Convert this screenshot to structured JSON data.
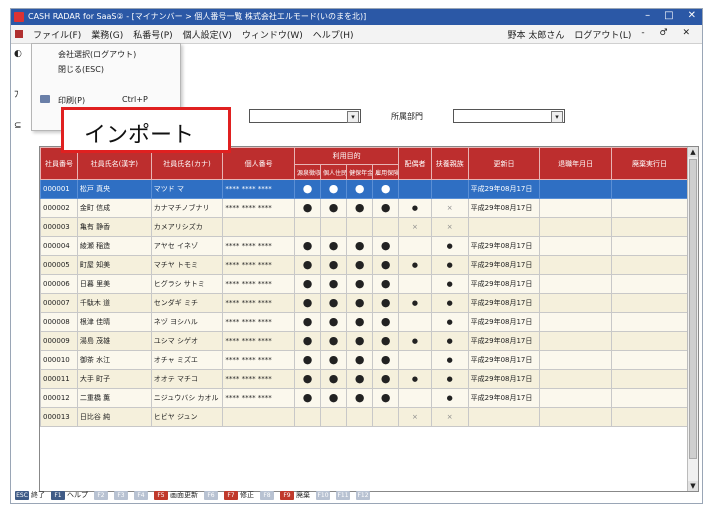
{
  "window": {
    "title": "CASH RADAR for SaaS② - [マイナンバー > 個人番号一覧 株式会社エルモード(いのまを北)]",
    "controls": [
      "–",
      "□",
      "✕"
    ]
  },
  "menubar": {
    "items": [
      "ファイル(F)",
      "業務(G)",
      "私番号(P)",
      "個人設定(V)",
      "ウィンドウ(W)",
      "ヘルプ(H)"
    ],
    "user": "野本 太郎さん",
    "logout": "ログアウト(L)",
    "mdi_controls": "- ♂ ✕"
  },
  "file_menu": {
    "items": [
      "会社選択(ログアウト)",
      "閉じる(ESC)",
      "印刷(P)"
    ],
    "print_shortcut": "Ctrl+P"
  },
  "import_callout": "インポート",
  "filters": {
    "left_label": "⊆",
    "dept_label": "所属部門",
    "select1": "",
    "select2": ""
  },
  "table": {
    "headers": [
      "社員番号",
      "社員氏名(漢字)",
      "社員氏名(カナ)",
      "個人番号",
      "扶養控除",
      "",
      "",
      "",
      "配偶者",
      "扶養親族",
      "更新日",
      "退職年月日",
      "廃棄実行日"
    ],
    "subheaders": [
      "源泉徴収",
      "個人住民税",
      "健保年金",
      "雇用保険"
    ],
    "group_header": "利用目的",
    "rows": [
      {
        "id": "000001",
        "kanji": "松戸 真央",
        "kana": "マツド マ",
        "num": "**** **** ****",
        "p1": "●",
        "p2": "●",
        "p3": "●",
        "p4": "●",
        "sp": "",
        "fam": "",
        "date": "平成29年08月17日",
        "sel": true
      },
      {
        "id": "000002",
        "kanji": "金町 信成",
        "kana": "カナマチノブナリ",
        "num": "**** **** ****",
        "p1": "●",
        "p2": "●",
        "p3": "●",
        "p4": "●",
        "sp": "●",
        "fam": "×",
        "date": "平成29年08月17日",
        "sel": false
      },
      {
        "id": "000003",
        "kanji": "亀有 静香",
        "kana": "カメアリシズカ",
        "num": "",
        "p1": "",
        "p2": "",
        "p3": "",
        "p4": "",
        "sp": "×",
        "fam": "×",
        "date": "",
        "sel": false
      },
      {
        "id": "000004",
        "kanji": "綾瀬 稲造",
        "kana": "アヤセ イネゾ",
        "num": "**** **** ****",
        "p1": "●",
        "p2": "●",
        "p3": "●",
        "p4": "●",
        "sp": "",
        "fam": "●",
        "date": "平成29年08月17日",
        "sel": false
      },
      {
        "id": "000005",
        "kanji": "町屋 知美",
        "kana": "マチヤ トモミ",
        "num": "**** **** ****",
        "p1": "●",
        "p2": "●",
        "p3": "●",
        "p4": "●",
        "sp": "●",
        "fam": "●",
        "date": "平成29年08月17日",
        "sel": false
      },
      {
        "id": "000006",
        "kanji": "日暮 里美",
        "kana": "ヒグラシ サトミ",
        "num": "**** **** ****",
        "p1": "●",
        "p2": "●",
        "p3": "●",
        "p4": "●",
        "sp": "",
        "fam": "●",
        "date": "平成29年08月17日",
        "sel": false
      },
      {
        "id": "000007",
        "kanji": "千駄木 道",
        "kana": "センダギ ミチ",
        "num": "**** **** ****",
        "p1": "●",
        "p2": "●",
        "p3": "●",
        "p4": "●",
        "sp": "●",
        "fam": "●",
        "date": "平成29年08月17日",
        "sel": false
      },
      {
        "id": "000008",
        "kanji": "根津 佳晴",
        "kana": "ネヅ ヨシハル",
        "num": "**** **** ****",
        "p1": "●",
        "p2": "●",
        "p3": "●",
        "p4": "●",
        "sp": "",
        "fam": "●",
        "date": "平成29年08月17日",
        "sel": false
      },
      {
        "id": "000009",
        "kanji": "湯島 茂雄",
        "kana": "ユシマ シゲオ",
        "num": "**** **** ****",
        "p1": "●",
        "p2": "●",
        "p3": "●",
        "p4": "●",
        "sp": "●",
        "fam": "●",
        "date": "平成29年08月17日",
        "sel": false
      },
      {
        "id": "000010",
        "kanji": "御茶 水江",
        "kana": "オチャ ミズエ",
        "num": "**** **** ****",
        "p1": "●",
        "p2": "●",
        "p3": "●",
        "p4": "●",
        "sp": "",
        "fam": "●",
        "date": "平成29年08月17日",
        "sel": false
      },
      {
        "id": "000011",
        "kanji": "大手 町子",
        "kana": "オオテ マチコ",
        "num": "**** **** ****",
        "p1": "●",
        "p2": "●",
        "p3": "●",
        "p4": "●",
        "sp": "●",
        "fam": "●",
        "date": "平成29年08月17日",
        "sel": false
      },
      {
        "id": "000012",
        "kanji": "二重橋 薫",
        "kana": "ニジュウバシ カオル",
        "num": "**** **** ****",
        "p1": "●",
        "p2": "●",
        "p3": "●",
        "p4": "●",
        "sp": "",
        "fam": "●",
        "date": "平成29年08月17日",
        "sel": false
      },
      {
        "id": "000013",
        "kanji": "日比谷 純",
        "kana": "ヒビヤ ジュン",
        "num": "",
        "p1": "",
        "p2": "",
        "p3": "",
        "p4": "",
        "sp": "×",
        "fam": "×",
        "date": "",
        "sel": false
      }
    ]
  },
  "fnbar": [
    {
      "key": "ESC",
      "label": "終了",
      "style": "normal"
    },
    {
      "key": "F1",
      "label": "ヘルプ",
      "style": "normal"
    },
    {
      "key": "F2",
      "label": "",
      "style": "dim"
    },
    {
      "key": "F3",
      "label": "",
      "style": "dim"
    },
    {
      "key": "F4",
      "label": "",
      "style": "dim"
    },
    {
      "key": "F5",
      "label": "画面更新",
      "style": "normal"
    },
    {
      "key": "F6",
      "label": "",
      "style": "dim"
    },
    {
      "key": "F7",
      "label": "修正",
      "style": "normal"
    },
    {
      "key": "F8",
      "label": "",
      "style": "dim"
    },
    {
      "key": "F9",
      "label": "廃棄",
      "style": "normal"
    },
    {
      "key": "F10",
      "label": "",
      "style": "dim"
    },
    {
      "key": "F11",
      "label": "",
      "style": "dim"
    },
    {
      "key": "F12",
      "label": "",
      "style": "dim"
    }
  ]
}
